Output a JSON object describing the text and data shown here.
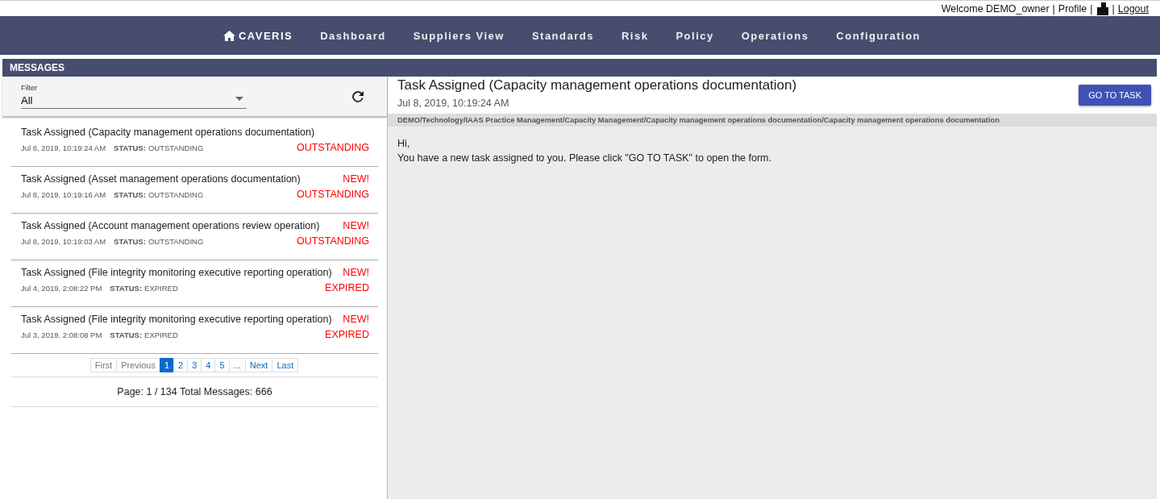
{
  "topbar": {
    "welcome": "Welcome DEMO_owner",
    "separator_1": "|",
    "profile": "Profile",
    "separator_2": "|",
    "separator_3": "|",
    "logout": "Logout"
  },
  "nav": {
    "brand": "CAVERIS",
    "items": [
      "Dashboard",
      "Suppliers View",
      "Standards",
      "Risk",
      "Policy",
      "Operations",
      "Configuration"
    ]
  },
  "section_title": "MESSAGES",
  "filter": {
    "label": "Filter",
    "value": "All"
  },
  "messages": [
    {
      "title": "Task Assigned (Capacity management operations documentation)",
      "date": "Jul 8, 2019, 10:19:24 AM",
      "status_label": "STATUS:",
      "status": "OUTSTANDING",
      "badge": "OUTSTANDING"
    },
    {
      "title": "Task Assigned (Asset management operations documentation)",
      "date": "Jul 8, 2019, 10:19:16 AM",
      "status_label": "STATUS:",
      "status": "OUTSTANDING",
      "new_label": "NEW!",
      "badge": "OUTSTANDING"
    },
    {
      "title": "Task Assigned (Account management operations review operation)",
      "date": "Jul 8, 2019, 10:19:03 AM",
      "status_label": "STATUS:",
      "status": "OUTSTANDING",
      "new_label": "NEW!",
      "badge": "OUTSTANDING"
    },
    {
      "title": "Task Assigned (File integrity monitoring executive reporting operation)",
      "date": "Jul 4, 2019, 2:08:22 PM",
      "status_label": "STATUS:",
      "status": "EXPIRED",
      "new_label": "NEW!",
      "badge": "EXPIRED"
    },
    {
      "title": "Task Assigned (File integrity monitoring executive reporting operation)",
      "date": "Jul 3, 2019, 2:08:08 PM",
      "status_label": "STATUS:",
      "status": "EXPIRED",
      "new_label": "NEW!",
      "badge": "EXPIRED"
    }
  ],
  "pagination": [
    {
      "label": "First",
      "disabled": true,
      "selected": false
    },
    {
      "label": "Previous",
      "disabled": true,
      "selected": false
    },
    {
      "label": "1",
      "disabled": false,
      "selected": true
    },
    {
      "label": "2",
      "disabled": false,
      "selected": false
    },
    {
      "label": "3",
      "disabled": false,
      "selected": false
    },
    {
      "label": "4",
      "disabled": false,
      "selected": false
    },
    {
      "label": "5",
      "disabled": false,
      "selected": false
    },
    {
      "label": "...",
      "disabled": false,
      "selected": false
    },
    {
      "label": "Next",
      "disabled": false,
      "selected": false
    },
    {
      "label": "Last",
      "disabled": false,
      "selected": false
    }
  ],
  "page_info": "Page: 1 / 134 Total Messages: 666",
  "detail": {
    "title": "Task Assigned (Capacity management operations documentation)",
    "date": "Jul 8, 2019, 10:19:24 AM",
    "button": "GO TO TASK",
    "path": "DEMO/Technology/IAAS Practice Management/Capacity Management/Capacity management operations documentation/Capacity management operations documentation",
    "body": [
      "Hi,",
      "You have a new task assigned to you. Please click \"GO TO TASK\" to open the form."
    ]
  }
}
